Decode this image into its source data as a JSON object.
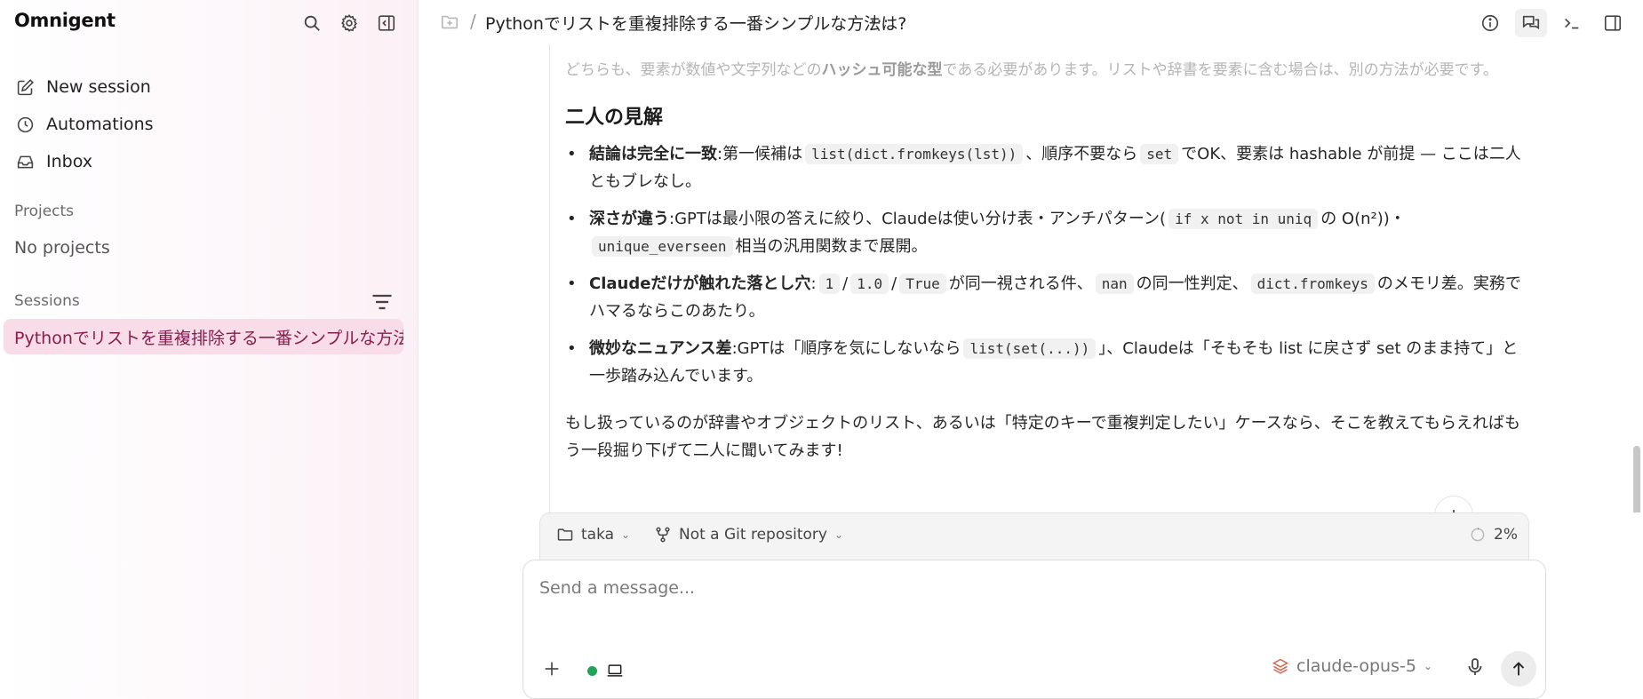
{
  "app": {
    "name": "Omnigent"
  },
  "sidebar": {
    "nav": [
      {
        "label": "New session",
        "icon": "edit-icon"
      },
      {
        "label": "Automations",
        "icon": "clock-icon"
      },
      {
        "label": "Inbox",
        "icon": "inbox-icon"
      }
    ],
    "projects_label": "Projects",
    "no_projects": "No projects",
    "sessions_label": "Sessions",
    "sessions": [
      {
        "title": "Pythonでリストを重複排除する一番シンプルな方法は?",
        "active": true
      }
    ]
  },
  "header": {
    "separator": "/",
    "title": "Pythonでリストを重複排除する一番シンプルな方法は?",
    "more": "···"
  },
  "content": {
    "faded_pre": "どちらも、要素が数値や文字列などの",
    "faded_bold": "ハッシュ可能な型",
    "faded_post": "である必要があります。リストや辞書を要素に含む場合は、別の方法が必要です。",
    "heading": "二人の見解",
    "bullet": "•",
    "b1": {
      "lead": "結論は完全に一致",
      "t1": ":第一候補は",
      "c1": "list(dict.fromkeys(lst))",
      "t2": "、順序不要なら",
      "c2": "set",
      "t3": "でOK、要素は hashable が前提 — ここは二人ともブレなし。"
    },
    "b2": {
      "lead": "深さが違う",
      "t1": ":GPTは最小限の答えに絞り、Claudeは使い分け表・アンチパターン(",
      "c1": "if x not in uniq",
      "t2": "の O(n²))・",
      "c2": "unique_everseen",
      "t3": "相当の汎用関数まで展開。"
    },
    "b3": {
      "lead": "Claudeだけが触れた落とし穴",
      "t1": ":",
      "c1": "1",
      "s1": "/",
      "c2": "1.0",
      "s2": "/",
      "c3": "True",
      "t2": "が同一視される件、",
      "c4": "nan",
      "t3": "の同一性判定、",
      "c5": "dict.fromkeys",
      "t4": "のメモリ差。実務でハマるならこのあたり。"
    },
    "b4": {
      "lead": "微妙なニュアンス差",
      "t1": ":GPTは「順序を気にしないなら",
      "c1": "list(set(...))",
      "t2": "」、Claudeは「そもそも list に戻さず set のまま持て」と一歩踏み込んでいます。"
    },
    "closing": "もし扱っているのが辞書やオブジェクトのリスト、あるいは「特定のキーで重複判定したい」ケースなら、そこを教えてもらえればもう一段掘り下げて二人に聞いてみます!"
  },
  "statusbar": {
    "folder": "taka",
    "git": "Not a Git repository",
    "context_usage": "2%"
  },
  "composer": {
    "placeholder": "Send a message...",
    "model": "claude-opus-5",
    "status_color": "#22a35a"
  },
  "colors": {
    "accent_bg": "#f8dce8",
    "accent_text": "#8a1d4f"
  }
}
